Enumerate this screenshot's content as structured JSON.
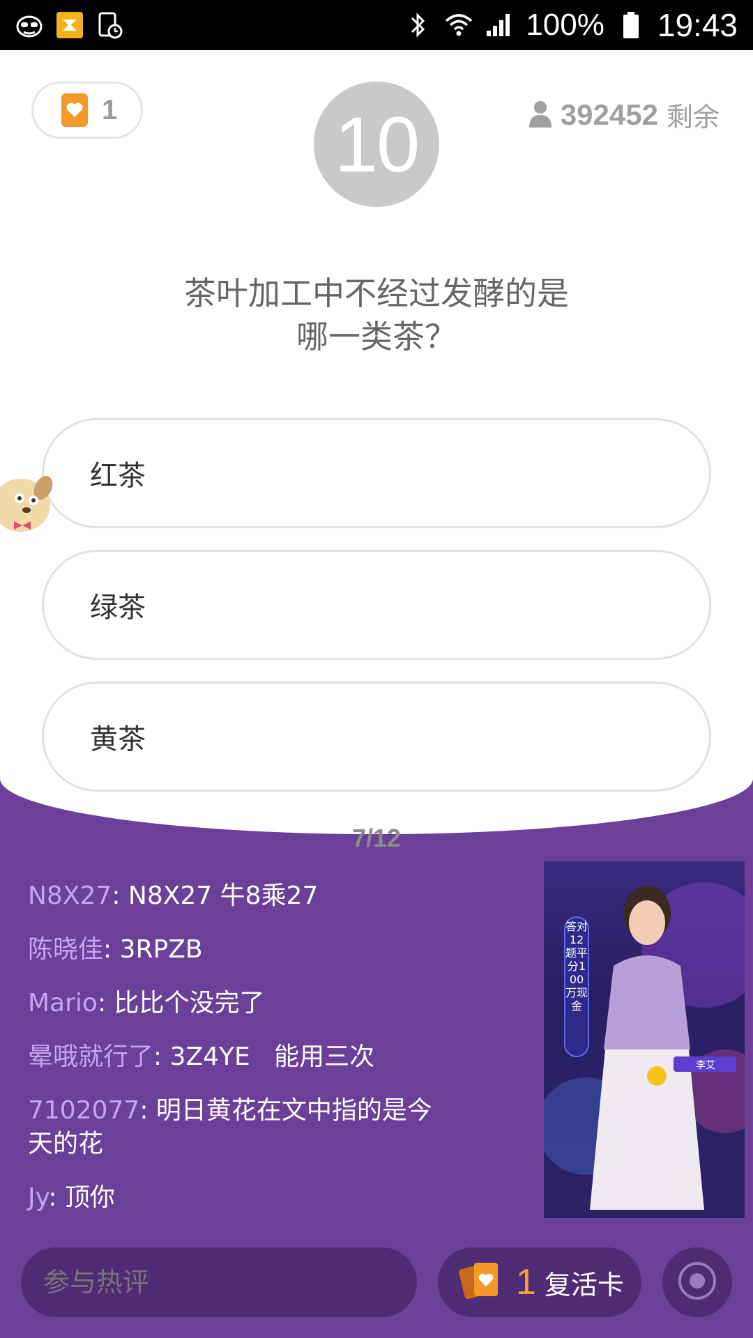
{
  "status_bar": {
    "battery": "100%",
    "time": "19:43",
    "icons": [
      "incognito-icon",
      "app-badge-icon",
      "clock-icon",
      "bluetooth-icon",
      "wifi-icon",
      "signal-icon",
      "battery-icon"
    ]
  },
  "lives": {
    "count": "1"
  },
  "timer": {
    "value": "10"
  },
  "players": {
    "count": "392452",
    "suffix": "剩余"
  },
  "question": {
    "line1": "茶叶加工中不经过发酵的是",
    "line2": "哪一类茶？"
  },
  "options": [
    "红茶",
    "绿茶",
    "黄茶"
  ],
  "progress": "7/12",
  "chat": [
    {
      "user": "N8X27",
      "text": ": N8X27 牛8乘27"
    },
    {
      "user": "陈晓佳",
      "text": ": 3RPZB"
    },
    {
      "user": "Mario",
      "text": ": 比比个没完了"
    },
    {
      "user": "晕哦就行了",
      "text": ": 3Z4YE   能用三次"
    },
    {
      "user": "7102077",
      "text": ": 明日黄花在文中指的是今天的花"
    },
    {
      "user": "Jy",
      "text": ": 顶你"
    }
  ],
  "video": {
    "banner": "答对12题平分100万现金",
    "host_name": "李艾"
  },
  "bottom": {
    "comment_placeholder": "参与热评",
    "revive_count": "1",
    "revive_label": "复活卡"
  },
  "colors": {
    "purple_bg": "#6c3f98",
    "accent_orange": "#f39a2b",
    "chat_username": "#c7a3f2"
  }
}
